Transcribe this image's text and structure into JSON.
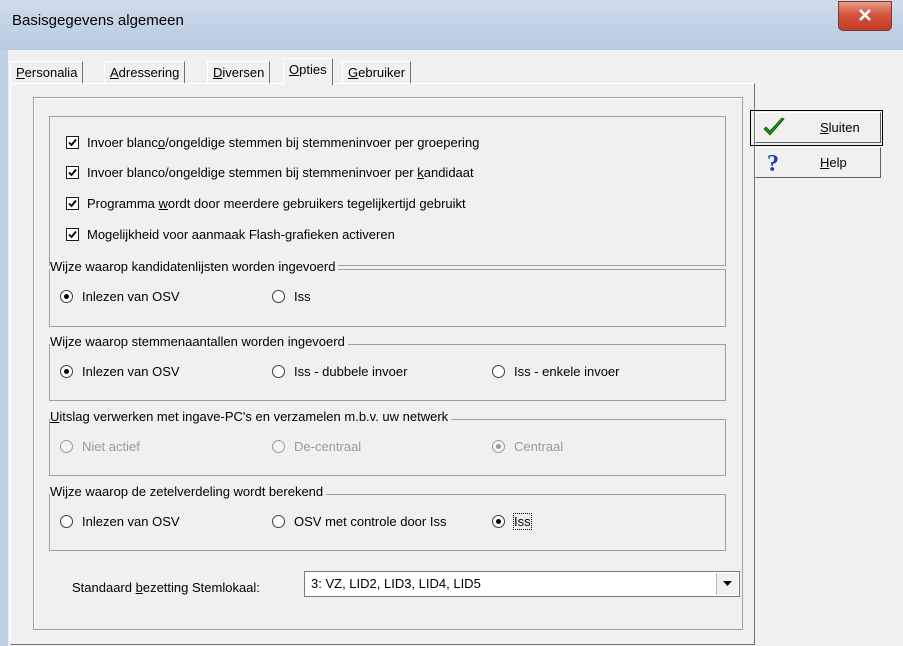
{
  "window": {
    "title": "Basisgegevens algemeen",
    "close_label": "X"
  },
  "tabs": [
    {
      "pre": "",
      "key": "P",
      "post": "ersonalia"
    },
    {
      "pre": "",
      "key": "A",
      "post": "dressering"
    },
    {
      "pre": "",
      "key": "D",
      "post": "iversen"
    },
    {
      "pre": "",
      "key": "O",
      "post": "pties"
    },
    {
      "pre": "",
      "key": "G",
      "post": "ebruiker"
    }
  ],
  "active_tab": "Opties",
  "checkboxes": [
    {
      "pre": "Invoer blanc",
      "key": "o",
      "post": "/ongeldige stemmen bij stemmeninvoer per groepering",
      "checked": true
    },
    {
      "pre": "Invoer blanco/ongeldige stemmen bij stemmeninvoer per ",
      "key": "k",
      "post": "andidaat",
      "checked": true
    },
    {
      "pre": "Programma ",
      "key": "w",
      "post": "ordt door meerdere gebruikers tegelijkertijd gebruikt",
      "checked": true
    },
    {
      "pre": "Mogelijkheid voor aanmaak Flash-grafieken activeren",
      "key": "",
      "post": "",
      "checked": true
    }
  ],
  "groups": {
    "kandidatenlijsten": {
      "legend": "Wijze waarop kandidatenlijsten worden ingevoerd",
      "options": [
        "Inlezen van OSV",
        "Iss"
      ],
      "selected": 0
    },
    "stemmenaantallen": {
      "legend": "Wijze waarop stemmenaantallen worden ingevoerd",
      "options": [
        "Inlezen van OSV",
        "Iss - dubbele invoer",
        "Iss - enkele invoer"
      ],
      "selected": 0
    },
    "uitslag": {
      "legend_key": "U",
      "legend_post": "itslag verwerken met ingave-PC's en verzamelen m.b.v. uw netwerk",
      "options": [
        "Niet actief",
        "De-centraal",
        "Centraal"
      ],
      "selected": 2,
      "disabled": true
    },
    "zetelverdeling": {
      "legend": "Wijze waarop de zetelverdeling wordt berekend",
      "options": [
        "Inlezen van OSV",
        "OSV met controle door Iss",
        "Iss"
      ],
      "selected": 2
    }
  },
  "bezetting": {
    "label_pre": "Standaard ",
    "label_key": "b",
    "label_post": "ezetting Stemlokaal:",
    "value": "3: VZ, LID2, LID3, LID4, LID5"
  },
  "buttons": {
    "close": {
      "key": "S",
      "post": "luiten",
      "icon": "checkmark-icon"
    },
    "help": {
      "key": "H",
      "post": "elp",
      "icon": "question-icon"
    }
  },
  "colors": {
    "check_green": "#1e8a1e",
    "help_blue": "#1a3fb0",
    "close_red": "#c43a24"
  }
}
